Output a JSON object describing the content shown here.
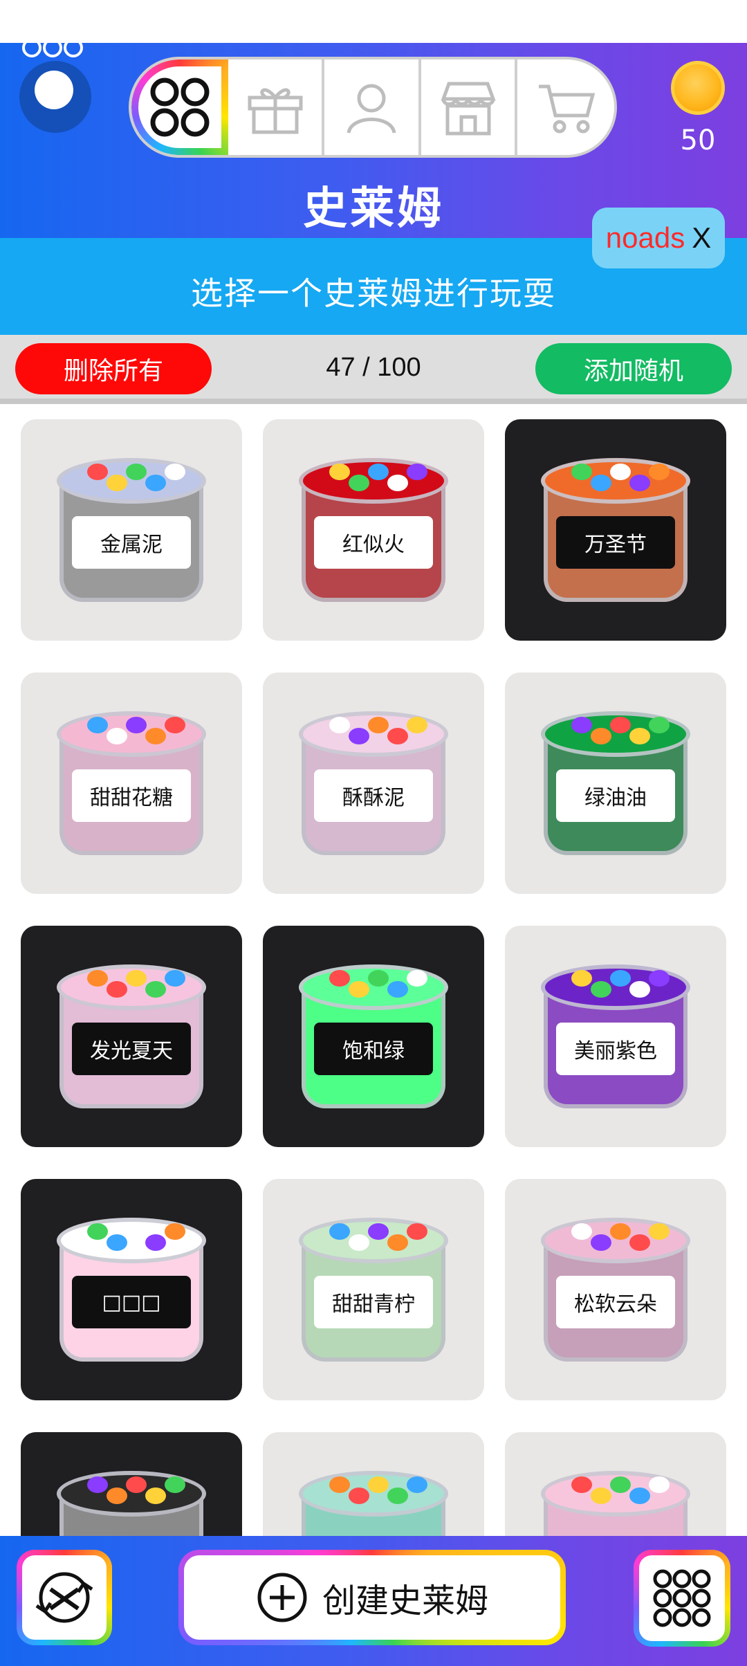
{
  "header": {
    "title": "史莱姆",
    "subtitle": "选择一个史莱姆进行玩耍",
    "coins": "50",
    "noads_label": "noads",
    "noads_close": "X"
  },
  "nav": {
    "tabs": [
      {
        "icon": "grid-icon",
        "active": true
      },
      {
        "icon": "gift-icon",
        "active": false
      },
      {
        "icon": "profile-icon",
        "active": false
      },
      {
        "icon": "store-icon",
        "active": false
      },
      {
        "icon": "cart-icon",
        "active": false
      }
    ]
  },
  "actions": {
    "delete_all": "删除所有",
    "counter": "47 / 100",
    "add_random": "添加随机"
  },
  "slimes": [
    {
      "name": "金属泥",
      "theme": "light",
      "color": "#9a9a9a",
      "top": "#bfc7e8"
    },
    {
      "name": "红似火",
      "theme": "light",
      "color": "#b5454a",
      "top": "#d20a18"
    },
    {
      "name": "万圣节",
      "theme": "dark",
      "color": "#c4704c",
      "top": "#f06b2a"
    },
    {
      "name": "甜甜花糖",
      "theme": "light",
      "color": "#d8b2c8",
      "top": "#f5b8d2"
    },
    {
      "name": "酥酥泥",
      "theme": "light",
      "color": "#d6b8cf",
      "top": "#f2d2e6"
    },
    {
      "name": "绿油油",
      "theme": "light",
      "color": "#3e8a5a",
      "top": "#10a343"
    },
    {
      "name": "发光夏天",
      "theme": "dark",
      "color": "#e3bcd6",
      "top": "#f6c4de"
    },
    {
      "name": "饱和绿",
      "theme": "dark",
      "color": "#4dff86",
      "top": "#5cff98"
    },
    {
      "name": "美丽紫色",
      "theme": "light",
      "color": "#8b4bc2",
      "top": "#6c24c8"
    },
    {
      "name": "□□□",
      "theme": "dark",
      "color": "#ffd3e6",
      "top": "#ffffff"
    },
    {
      "name": "甜甜青柠",
      "theme": "light",
      "color": "#b6d8b6",
      "top": "#c9e9c9"
    },
    {
      "name": "松软云朵",
      "theme": "light",
      "color": "#c69fb8",
      "top": "#f0bad5"
    },
    {
      "name": "",
      "theme": "dark",
      "color": "#8a8a8a",
      "top": "#2b2b2b"
    },
    {
      "name": "",
      "theme": "light",
      "color": "#8ad2bf",
      "top": "#a7e1d2"
    },
    {
      "name": "",
      "theme": "light",
      "color": "#e7b7d2",
      "top": "#f7c6dd"
    }
  ],
  "bottom": {
    "create_label": "创建史莱姆",
    "left_icon": "shuffle-icon",
    "right_icon": "grid-icon"
  },
  "colors": {
    "header_gradient": [
      "#1667f0",
      "#7d3fe0"
    ],
    "subbanner": "#16a8f2",
    "delete": "#ff0808",
    "random": "#13bb63"
  }
}
